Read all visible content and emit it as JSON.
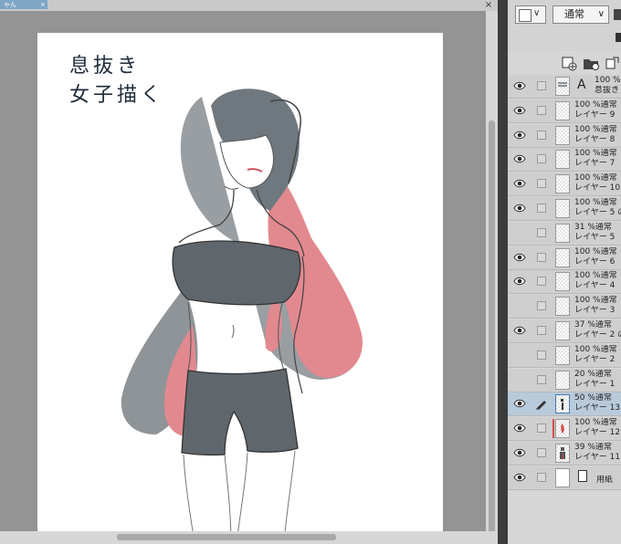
{
  "document_tab": {
    "label": "ゃん",
    "close": "×"
  },
  "window": {
    "close": "×"
  },
  "canvas": {
    "title_line1": "息抜き",
    "title_line2": "女子描く"
  },
  "panel": {
    "blend_mode": "通常",
    "dropdown_arrow": "∨"
  },
  "layers": [
    {
      "opacity": "100 %",
      "mode": "通常",
      "name": "息抜き",
      "type": "text",
      "visible": true
    },
    {
      "opacity": "100 %",
      "mode": "通常",
      "name": "レイヤー 9",
      "visible": true
    },
    {
      "opacity": "100 %",
      "mode": "通常",
      "name": "レイヤー 8",
      "visible": true
    },
    {
      "opacity": "100 %",
      "mode": "通常",
      "name": "レイヤー 7",
      "visible": true
    },
    {
      "opacity": "100 %",
      "mode": "通常",
      "name": "レイヤー 10",
      "visible": true
    },
    {
      "opacity": "100 %",
      "mode": "通常",
      "name": "レイヤー 5 の",
      "visible": true
    },
    {
      "opacity": "31 %",
      "mode": "通常",
      "name": "レイヤー 5",
      "visible": false
    },
    {
      "opacity": "100 %",
      "mode": "通常",
      "name": "レイヤー 6",
      "visible": true
    },
    {
      "opacity": "100 %",
      "mode": "通常",
      "name": "レイヤー 4",
      "visible": true
    },
    {
      "opacity": "100 %",
      "mode": "通常",
      "name": "レイヤー 3",
      "visible": false
    },
    {
      "opacity": "37 %",
      "mode": "通常",
      "name": "レイヤー 2 の",
      "visible": true
    },
    {
      "opacity": "100 %",
      "mode": "通常",
      "name": "レイヤー 2",
      "visible": false
    },
    {
      "opacity": "20 %",
      "mode": "通常",
      "name": "レイヤー 1",
      "visible": false
    },
    {
      "opacity": "50 %",
      "mode": "通常",
      "name": "レイヤー 13",
      "visible": true,
      "selected": true
    },
    {
      "opacity": "100 %",
      "mode": "通常",
      "name": "レイヤー 12",
      "visible": true
    },
    {
      "opacity": "39 %",
      "mode": "通常",
      "name": "レイヤー 11",
      "visible": true
    },
    {
      "opacity": "",
      "mode": "",
      "name": "用紙",
      "type": "paper",
      "visible": true
    }
  ]
}
